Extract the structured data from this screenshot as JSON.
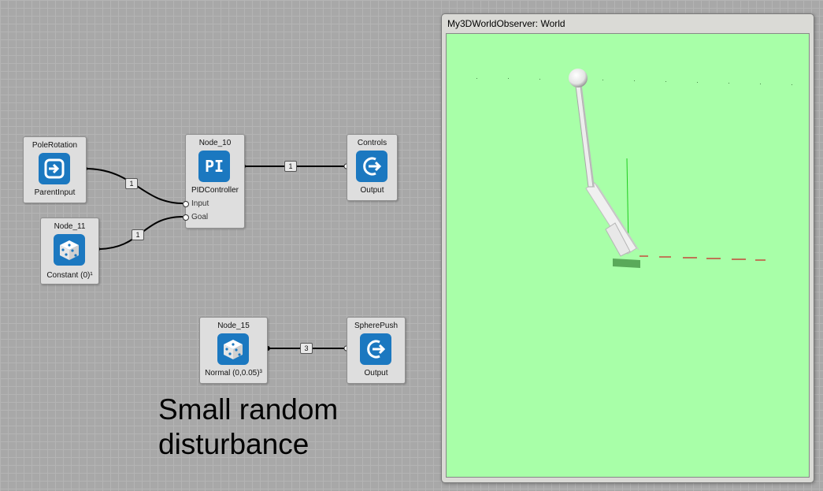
{
  "nodes": {
    "pole_rotation": {
      "title": "PoleRotation",
      "sub": "ParentInput",
      "icon": "input-arrow-icon"
    },
    "node_11": {
      "title": "Node_11",
      "sub": "Constant (0)¹",
      "icon": "dice-icon"
    },
    "node_10": {
      "title": "Node_10",
      "glyph": "PI",
      "sub": "PIDController",
      "port_input": "Input",
      "port_goal": "Goal"
    },
    "controls": {
      "title": "Controls",
      "sub": "Output",
      "icon": "output-arrow-icon"
    },
    "node_15": {
      "title": "Node_15",
      "sub": "Normal (0,0.05)³",
      "icon": "dice-icon"
    },
    "sphere_push": {
      "title": "SpherePush",
      "sub": "Output",
      "icon": "output-arrow-icon"
    }
  },
  "wires": {
    "pole_to_input": "1",
    "const_to_goal": "1",
    "pid_to_controls": "1",
    "normal_to_push": "3"
  },
  "annotation": {
    "line1": "Small random",
    "line2": "disturbance"
  },
  "observer": {
    "title": "My3DWorldObserver: World"
  },
  "colors": {
    "icon_bg": "#1b78c0",
    "viewport_bg": "#a8ffa8",
    "canvas_bg": "#a8a8a8"
  }
}
